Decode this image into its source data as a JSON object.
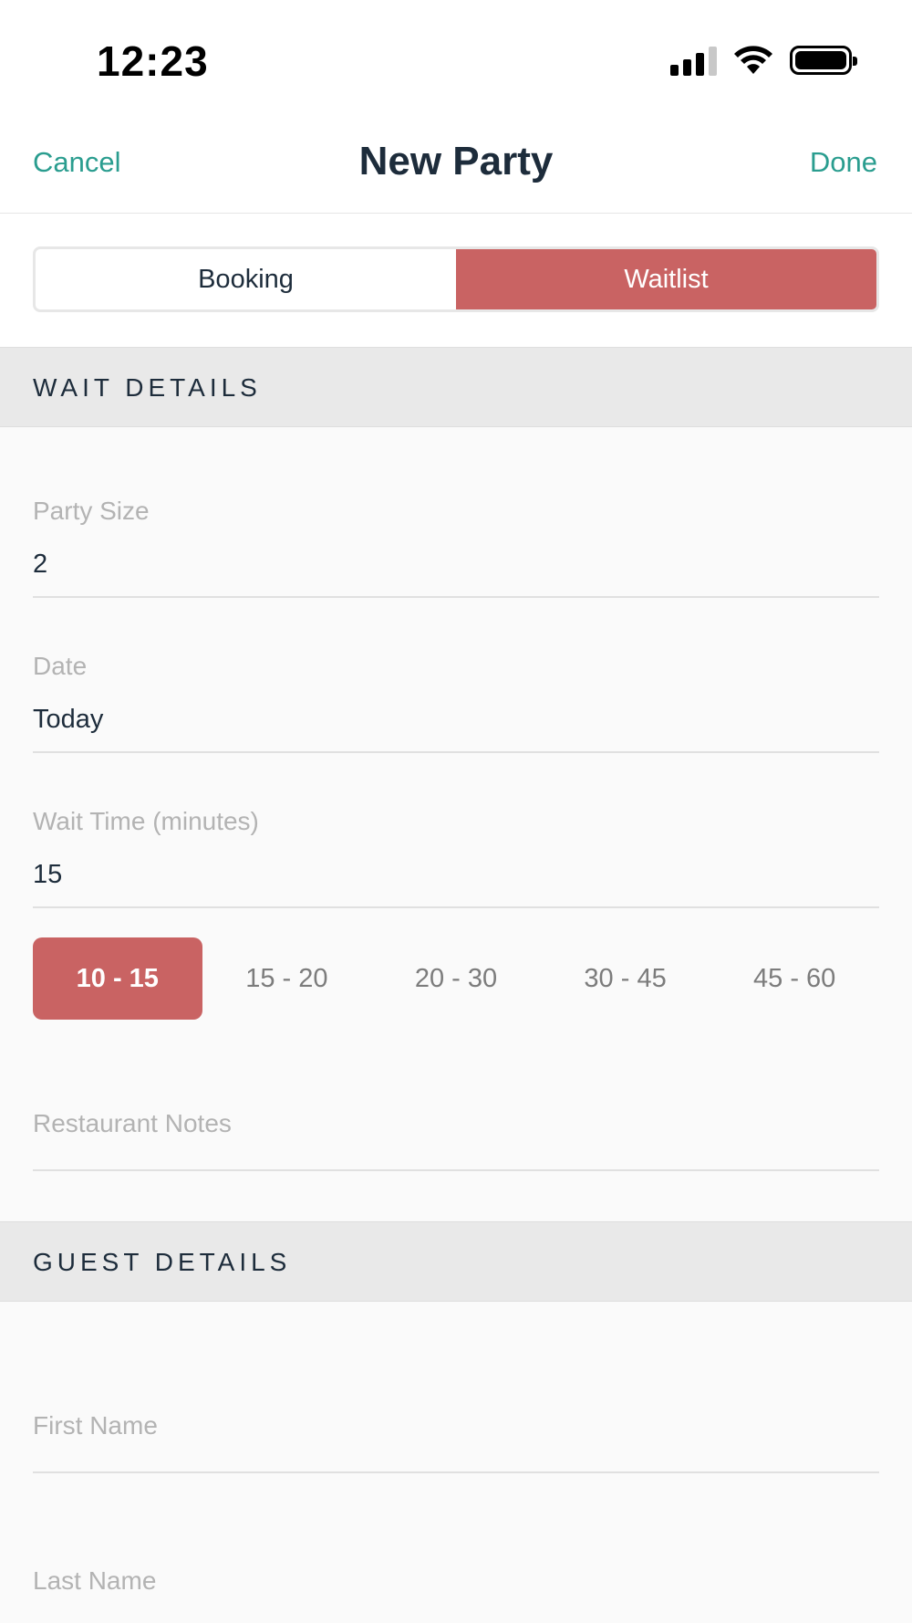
{
  "status_bar": {
    "time": "12:23"
  },
  "nav": {
    "cancel": "Cancel",
    "title": "New Party",
    "done": "Done"
  },
  "segments": [
    {
      "label": "Booking",
      "active": false
    },
    {
      "label": "Waitlist",
      "active": true
    }
  ],
  "wait_details": {
    "header": "WAIT DETAILS",
    "party_size": {
      "label": "Party Size",
      "value": "2"
    },
    "date": {
      "label": "Date",
      "value": "Today"
    },
    "wait_time": {
      "label": "Wait Time (minutes)",
      "value": "15"
    },
    "wait_options": [
      "10 - 15",
      "15 - 20",
      "20 - 30",
      "30 - 45",
      "45 - 60"
    ],
    "selected_wait_option": "10 - 15",
    "restaurant_notes": {
      "placeholder": "Restaurant Notes"
    }
  },
  "guest_details": {
    "header": "GUEST DETAILS",
    "first_name": {
      "placeholder": "First Name"
    },
    "last_name": {
      "placeholder": "Last Name"
    }
  },
  "colors": {
    "accent": "#c96363",
    "link": "#2a9d8f",
    "text": "#1d2c3b"
  }
}
